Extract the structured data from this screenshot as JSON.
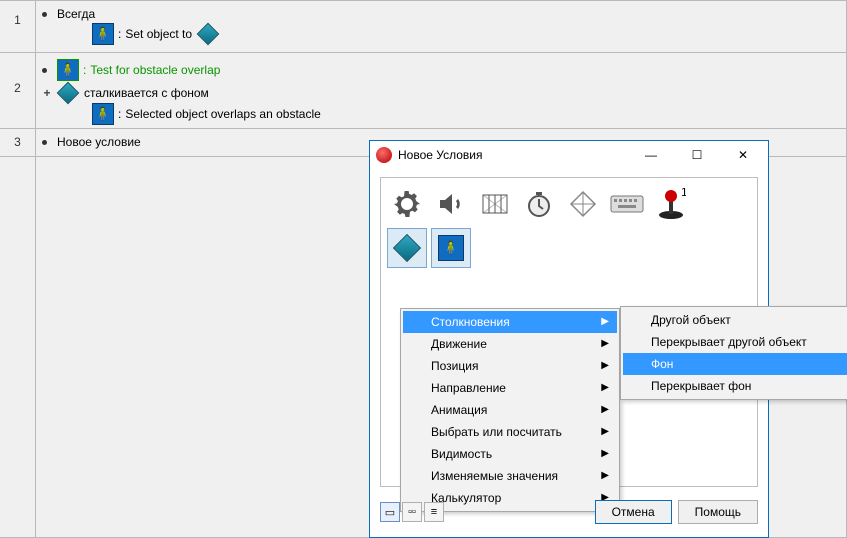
{
  "editor": {
    "rows": [
      {
        "num": "1",
        "condition": "Всегда",
        "action": "Set object to"
      },
      {
        "num": "2",
        "cond1": "Test for obstacle overlap",
        "cond2": "сталкивается с фоном",
        "action": "Selected object overlaps an obstacle"
      },
      {
        "num": "3",
        "condition": "Новое условие"
      }
    ],
    "colon": ":"
  },
  "dialog": {
    "title": "Новое Условия",
    "win": {
      "min": "—",
      "max": "☐",
      "close": "✕"
    },
    "icons": {
      "gear": "gear-icon",
      "speaker": "speaker-icon",
      "storyboard": "storyboard-icon",
      "timer": "timer-icon",
      "create": "create-icon",
      "keyboard": "keyboard-icon",
      "joystick": "joystick-icon"
    },
    "menu": {
      "items": [
        {
          "label": "Столкновения",
          "arrow": true,
          "highlight": true
        },
        {
          "label": "Движение",
          "arrow": true
        },
        {
          "label": "Позиция",
          "arrow": true
        },
        {
          "label": "Направление",
          "arrow": true
        },
        {
          "label": "Анимация",
          "arrow": true
        },
        {
          "label": "Выбрать или посчитать",
          "arrow": true
        },
        {
          "label": "Видимость",
          "arrow": true
        },
        {
          "label": "Изменяемые значения",
          "arrow": true
        },
        {
          "label": "Калькулятор",
          "arrow": true
        }
      ]
    },
    "submenu": {
      "items": [
        {
          "label": "Другой объект"
        },
        {
          "label": "Перекрывает другой объект"
        },
        {
          "label": "Фон",
          "highlight": true
        },
        {
          "label": "Перекрывает фон"
        }
      ]
    },
    "buttons": {
      "cancel": "Отмена",
      "help": "Помощь"
    }
  }
}
